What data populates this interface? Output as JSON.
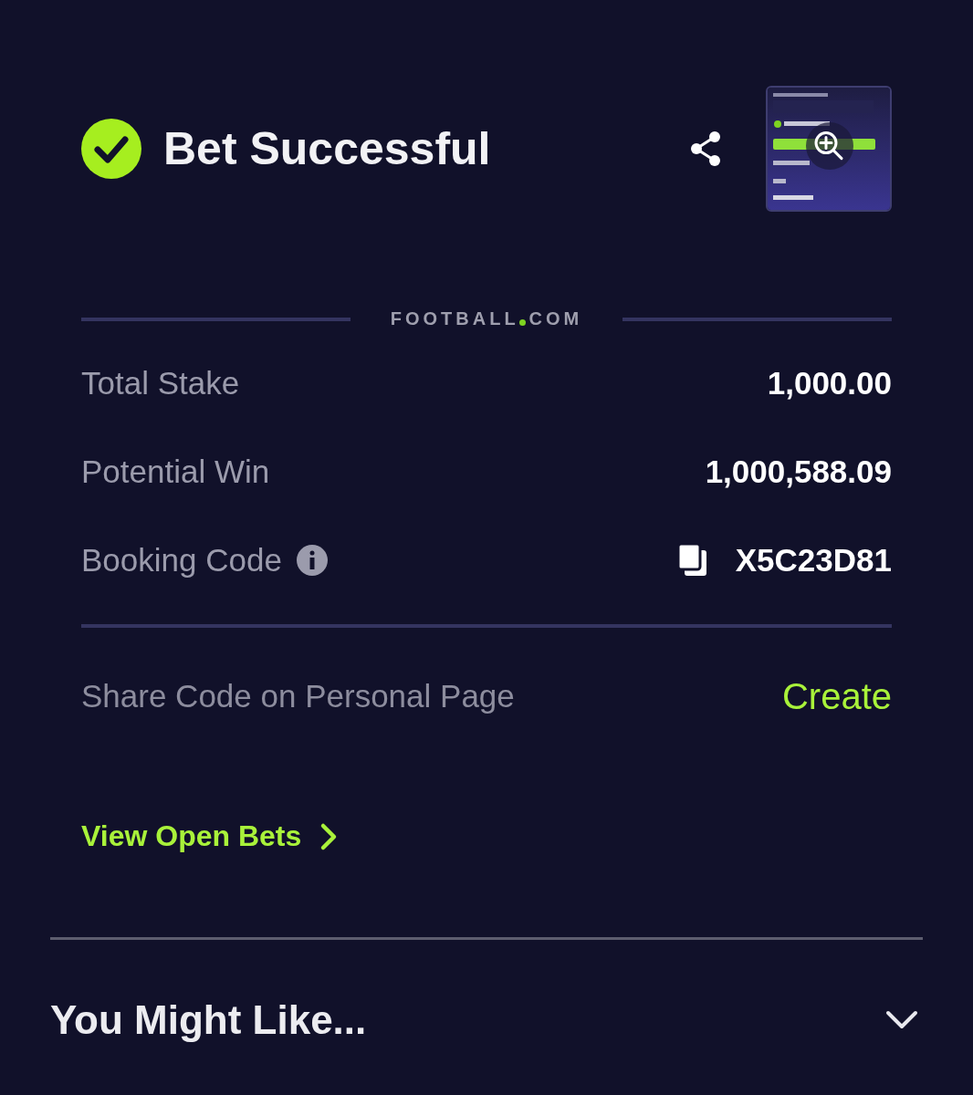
{
  "header": {
    "title": "Bet Successful"
  },
  "logo": {
    "left": "FOOTBALL",
    "right": "COM"
  },
  "details": [
    {
      "kind": "plain",
      "label": "Total Stake",
      "value": "1,000.00"
    },
    {
      "kind": "plain",
      "label": "Potential Win",
      "value": "1,000,588.09"
    },
    {
      "kind": "code",
      "label": "Booking Code",
      "value": "X5C23D81"
    }
  ],
  "share": {
    "label": "Share Code on Personal Page",
    "action": "Create"
  },
  "open_bets_link": "View Open Bets",
  "section": {
    "title": "You Might Like...",
    "expanded": false
  }
}
